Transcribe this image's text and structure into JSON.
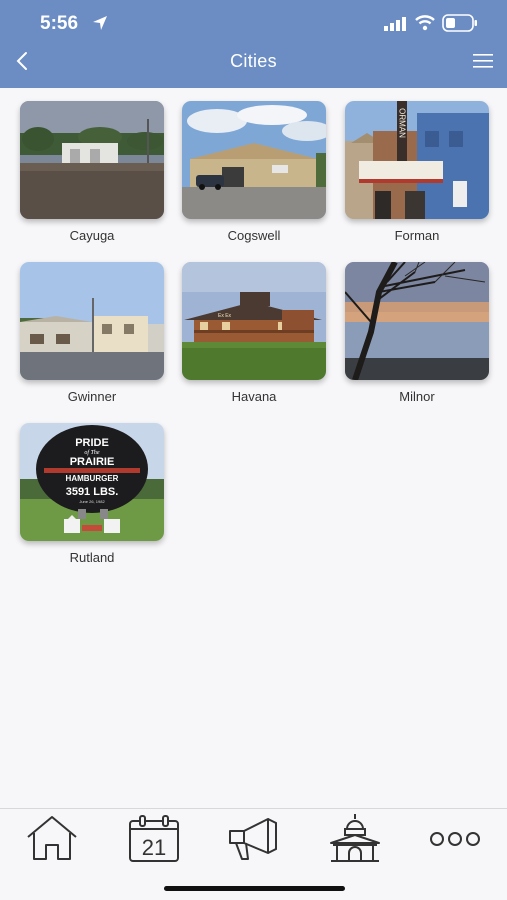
{
  "status_bar": {
    "time": "5:56"
  },
  "nav": {
    "title": "Cities"
  },
  "cities": [
    {
      "name": "Cayuga"
    },
    {
      "name": "Cogswell"
    },
    {
      "name": "Forman"
    },
    {
      "name": "Gwinner"
    },
    {
      "name": "Havana"
    },
    {
      "name": "Milnor"
    },
    {
      "name": "Rutland"
    }
  ],
  "photo_text": {
    "forman_sign": "ORMAN",
    "havana_sign": "Ex Ex",
    "rutland_line1": "PRIDE",
    "rutland_line2": "of The",
    "rutland_line3": "PRAIRIE",
    "rutland_line4": "HAMBURGER",
    "rutland_line5": "3591 LBS.",
    "rutland_line6": "June 26, 1982"
  },
  "tabbar": {
    "calendar_day": "21",
    "tabs": [
      "home-icon",
      "calendar-icon",
      "megaphone-icon",
      "city-hall-icon",
      "more-icon"
    ]
  },
  "colors": {
    "header": "#6b8dc4",
    "background": "#f7f7f9",
    "icon_stroke": "#333333"
  }
}
